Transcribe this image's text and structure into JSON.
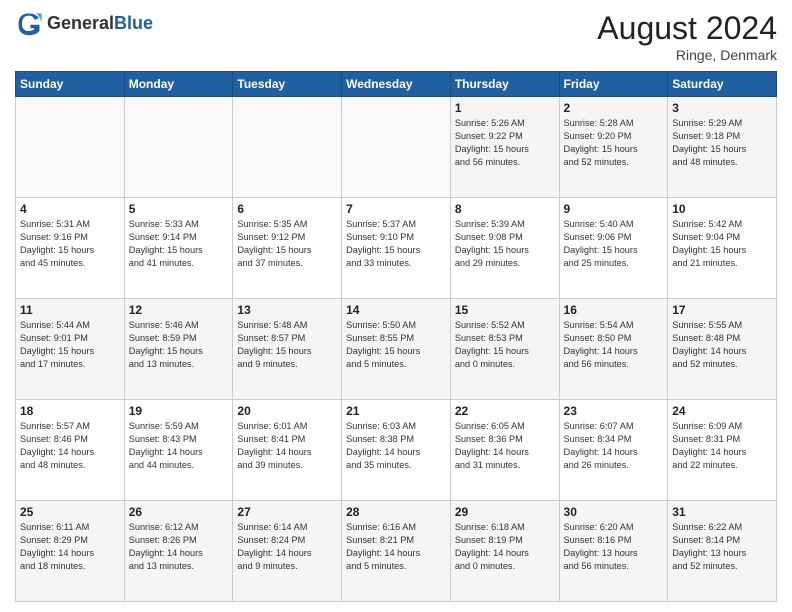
{
  "header": {
    "logo_general": "General",
    "logo_blue": "Blue",
    "month_year": "August 2024",
    "location": "Ringe, Denmark"
  },
  "days_of_week": [
    "Sunday",
    "Monday",
    "Tuesday",
    "Wednesday",
    "Thursday",
    "Friday",
    "Saturday"
  ],
  "weeks": [
    [
      {
        "day": "",
        "info": ""
      },
      {
        "day": "",
        "info": ""
      },
      {
        "day": "",
        "info": ""
      },
      {
        "day": "",
        "info": ""
      },
      {
        "day": "1",
        "info": "Sunrise: 5:26 AM\nSunset: 9:22 PM\nDaylight: 15 hours\nand 56 minutes."
      },
      {
        "day": "2",
        "info": "Sunrise: 5:28 AM\nSunset: 9:20 PM\nDaylight: 15 hours\nand 52 minutes."
      },
      {
        "day": "3",
        "info": "Sunrise: 5:29 AM\nSunset: 9:18 PM\nDaylight: 15 hours\nand 48 minutes."
      }
    ],
    [
      {
        "day": "4",
        "info": "Sunrise: 5:31 AM\nSunset: 9:16 PM\nDaylight: 15 hours\nand 45 minutes."
      },
      {
        "day": "5",
        "info": "Sunrise: 5:33 AM\nSunset: 9:14 PM\nDaylight: 15 hours\nand 41 minutes."
      },
      {
        "day": "6",
        "info": "Sunrise: 5:35 AM\nSunset: 9:12 PM\nDaylight: 15 hours\nand 37 minutes."
      },
      {
        "day": "7",
        "info": "Sunrise: 5:37 AM\nSunset: 9:10 PM\nDaylight: 15 hours\nand 33 minutes."
      },
      {
        "day": "8",
        "info": "Sunrise: 5:39 AM\nSunset: 9:08 PM\nDaylight: 15 hours\nand 29 minutes."
      },
      {
        "day": "9",
        "info": "Sunrise: 5:40 AM\nSunset: 9:06 PM\nDaylight: 15 hours\nand 25 minutes."
      },
      {
        "day": "10",
        "info": "Sunrise: 5:42 AM\nSunset: 9:04 PM\nDaylight: 15 hours\nand 21 minutes."
      }
    ],
    [
      {
        "day": "11",
        "info": "Sunrise: 5:44 AM\nSunset: 9:01 PM\nDaylight: 15 hours\nand 17 minutes."
      },
      {
        "day": "12",
        "info": "Sunrise: 5:46 AM\nSunset: 8:59 PM\nDaylight: 15 hours\nand 13 minutes."
      },
      {
        "day": "13",
        "info": "Sunrise: 5:48 AM\nSunset: 8:57 PM\nDaylight: 15 hours\nand 9 minutes."
      },
      {
        "day": "14",
        "info": "Sunrise: 5:50 AM\nSunset: 8:55 PM\nDaylight: 15 hours\nand 5 minutes."
      },
      {
        "day": "15",
        "info": "Sunrise: 5:52 AM\nSunset: 8:53 PM\nDaylight: 15 hours\nand 0 minutes."
      },
      {
        "day": "16",
        "info": "Sunrise: 5:54 AM\nSunset: 8:50 PM\nDaylight: 14 hours\nand 56 minutes."
      },
      {
        "day": "17",
        "info": "Sunrise: 5:55 AM\nSunset: 8:48 PM\nDaylight: 14 hours\nand 52 minutes."
      }
    ],
    [
      {
        "day": "18",
        "info": "Sunrise: 5:57 AM\nSunset: 8:46 PM\nDaylight: 14 hours\nand 48 minutes."
      },
      {
        "day": "19",
        "info": "Sunrise: 5:59 AM\nSunset: 8:43 PM\nDaylight: 14 hours\nand 44 minutes."
      },
      {
        "day": "20",
        "info": "Sunrise: 6:01 AM\nSunset: 8:41 PM\nDaylight: 14 hours\nand 39 minutes."
      },
      {
        "day": "21",
        "info": "Sunrise: 6:03 AM\nSunset: 8:38 PM\nDaylight: 14 hours\nand 35 minutes."
      },
      {
        "day": "22",
        "info": "Sunrise: 6:05 AM\nSunset: 8:36 PM\nDaylight: 14 hours\nand 31 minutes."
      },
      {
        "day": "23",
        "info": "Sunrise: 6:07 AM\nSunset: 8:34 PM\nDaylight: 14 hours\nand 26 minutes."
      },
      {
        "day": "24",
        "info": "Sunrise: 6:09 AM\nSunset: 8:31 PM\nDaylight: 14 hours\nand 22 minutes."
      }
    ],
    [
      {
        "day": "25",
        "info": "Sunrise: 6:11 AM\nSunset: 8:29 PM\nDaylight: 14 hours\nand 18 minutes."
      },
      {
        "day": "26",
        "info": "Sunrise: 6:12 AM\nSunset: 8:26 PM\nDaylight: 14 hours\nand 13 minutes."
      },
      {
        "day": "27",
        "info": "Sunrise: 6:14 AM\nSunset: 8:24 PM\nDaylight: 14 hours\nand 9 minutes."
      },
      {
        "day": "28",
        "info": "Sunrise: 6:16 AM\nSunset: 8:21 PM\nDaylight: 14 hours\nand 5 minutes."
      },
      {
        "day": "29",
        "info": "Sunrise: 6:18 AM\nSunset: 8:19 PM\nDaylight: 14 hours\nand 0 minutes."
      },
      {
        "day": "30",
        "info": "Sunrise: 6:20 AM\nSunset: 8:16 PM\nDaylight: 13 hours\nand 56 minutes."
      },
      {
        "day": "31",
        "info": "Sunrise: 6:22 AM\nSunset: 8:14 PM\nDaylight: 13 hours\nand 52 minutes."
      }
    ]
  ]
}
